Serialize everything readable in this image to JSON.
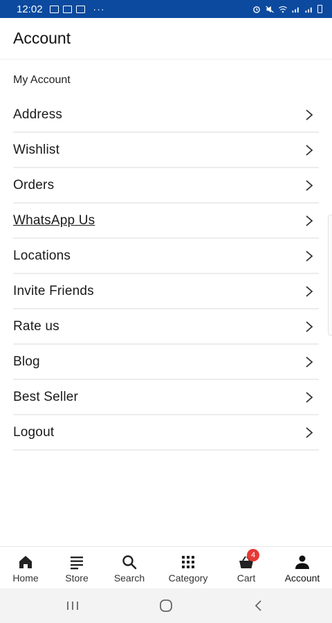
{
  "status_bar": {
    "time": "12:02",
    "overflow": "···",
    "icons": [
      "image-icon",
      "gallery-icon",
      "calendar-icon",
      "alarm-icon",
      "mute-icon",
      "wifi-icon",
      "signal-icon",
      "battery-icon"
    ]
  },
  "header": {
    "title": "Account"
  },
  "menu": {
    "section_label": "My Account",
    "items": [
      {
        "label": "Address"
      },
      {
        "label": "Wishlist"
      },
      {
        "label": "Orders"
      },
      {
        "label": "WhatsApp Us"
      },
      {
        "label": "Locations"
      },
      {
        "label": "Invite Friends"
      },
      {
        "label": "Rate us"
      },
      {
        "label": "Blog"
      },
      {
        "label": "Best Seller"
      },
      {
        "label": "Logout"
      }
    ]
  },
  "bottom_nav": {
    "items": [
      {
        "label": "Home",
        "icon": "home-icon"
      },
      {
        "label": "Store",
        "icon": "list-icon"
      },
      {
        "label": "Search",
        "icon": "search-icon"
      },
      {
        "label": "Category",
        "icon": "grid-icon"
      },
      {
        "label": "Cart",
        "icon": "basket-icon",
        "badge": "4"
      },
      {
        "label": "Account",
        "icon": "person-icon",
        "active": true
      }
    ]
  },
  "colors": {
    "status_bar": "#0b4a9e",
    "badge": "#e53935"
  }
}
